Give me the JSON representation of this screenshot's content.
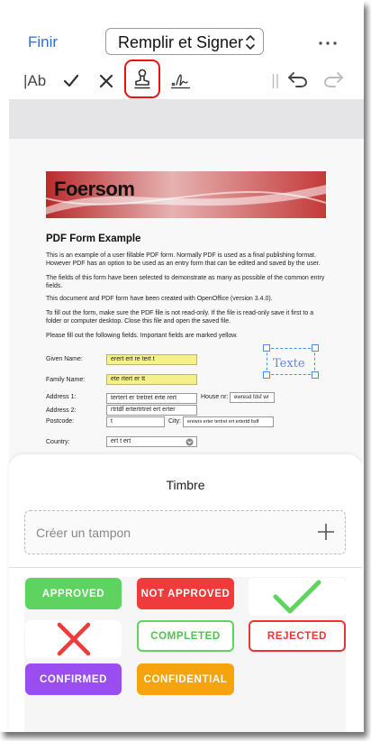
{
  "nav": {
    "done_label": "Finir",
    "mode_label": "Remplir et Signer"
  },
  "toolbar": {
    "text_tool_label": "|Ab"
  },
  "document": {
    "banner_title": "Foersom",
    "heading": "PDF Form Example",
    "paragraphs": [
      "This is an example of a user fillable PDF form. Normally PDF is used as a final publishing format. However PDF has an option to be used as an entry form that can be edited and saved by the user.",
      "The fields of this form have been selected to demonstrate as many as possible of the common entry fields.",
      "This document and PDF form have been created with OpenOffice (version 3.4.0).",
      "To fill out the form, make sure the PDF file is not read-only. If the file is read-only save it first to a folder or computer desktop. Close this file and open the saved file.",
      "Please fill out the following fields. Important fields are marked yellow."
    ],
    "fields": {
      "given_name_label": "Given Name:",
      "given_name_value": "erert ert re tert t",
      "family_name_label": "Family Name:",
      "family_name_value": "ete rtert er tt",
      "address1_label": "Address 1:",
      "address1_value": "tertert er tretret  erte rert",
      "house_nr_label": "House nr:",
      "house_nr_value": "ewresd fdsf wr",
      "address2_label": "Address 2:",
      "address2_value": "rtrtdf ertertrtret ert erter",
      "postcode_label": "Postcode:",
      "postcode_value": "t",
      "city_label": "City:",
      "city_value": "erewrs erter tertret ert ertertd fsdf",
      "country_label": "Country:",
      "country_value": "ert t ert"
    },
    "text_annotation": "Texte"
  },
  "sheet": {
    "title": "Timbre",
    "create_label": "Créer un tampon",
    "stamps": {
      "approved": "APPROVED",
      "not_approved": "NOT APPROVED",
      "completed": "COMPLETED",
      "rejected": "REJECTED",
      "confirmed": "CONFIRMED",
      "confidential": "CONFIDENTIAL"
    }
  },
  "colors": {
    "accent_blue": "#2f6fdb",
    "highlight_red": "#e11111",
    "approved_green": "#5fd35f",
    "not_approved_red": "#ef3b3b",
    "confirmed_purple": "#9a4df0",
    "confidential_orange": "#f6a40e",
    "field_yellow": "#f4f08a"
  },
  "icons": [
    "checkmark-icon",
    "close-icon",
    "stamp-icon",
    "signature-icon",
    "undo-icon",
    "redo-icon",
    "more-icon",
    "chevron-updown-icon",
    "plus-icon"
  ]
}
